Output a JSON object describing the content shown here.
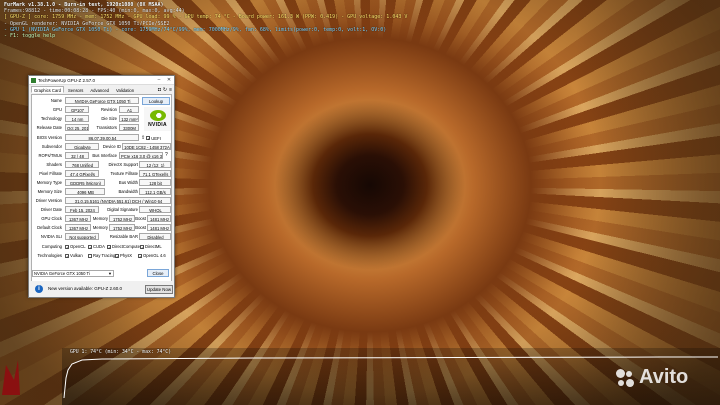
{
  "overlay": {
    "lines": [
      "FurMark v1.38.1.0 - Burn-in test, 1920x1080 (0X MSAA)",
      "Frames:98812 - time:00:08:28 - FPS:40 (min:0, max:0, avg:44)",
      "[ GPU-Z ] core: 1759 MHz - mem: 1752 MHz - GPU load: 99 % - GPU temp: 74 °C - Board power: 161.3 W (PPW: 0.419) - GPU voltage: 1.043 V",
      "- OpenGL renderer: NVIDIA GeForce GTX 1050 Ti/PCIe/SSE2",
      "- GPU 1 (NVIDIA GeForce GTX 1050 Ti) - core: 1759MHz/74°C/99%, mem: 7000MHz/9%, fan: 68%, limits(power:0, temp:0, volt:1, OV:0)",
      "- F1: toggle help"
    ]
  },
  "gpuz": {
    "title": "TechPowerUp GPU-Z 2.57.0",
    "tabs": [
      "Graphics Card",
      "Sensors",
      "Advanced",
      "Validation"
    ],
    "tab_icons": [
      "camera-icon",
      "refresh-icon",
      "menu-icon"
    ],
    "lookup_label": "Lookup",
    "nvidia_word": "NVIDIA",
    "uefi_label": "UEFI",
    "fields": {
      "name": {
        "label": "Name",
        "value": "NVIDIA GeForce GTX 1050 Ti"
      },
      "gpu": {
        "label": "GPU",
        "value": "GP107"
      },
      "revision": {
        "label": "Revision",
        "value": "A1"
      },
      "technology": {
        "label": "Technology",
        "value": "14 nm"
      },
      "die_size": {
        "label": "Die Size",
        "value": "132 mm²"
      },
      "release_date": {
        "label": "Release Date",
        "value": "Oct 25, 2016"
      },
      "transistors": {
        "label": "Transistors",
        "value": "3300M"
      },
      "bios": {
        "label": "BIOS Version",
        "value": "86.07.39.00.54"
      },
      "subvendor": {
        "label": "Subvendor",
        "value": "Gigabyte"
      },
      "device_id": {
        "label": "Device ID",
        "value": "10DE 1C82 - 1458 372A"
      },
      "rops": {
        "label": "ROPs/TMUs",
        "value": "32 / 48"
      },
      "bus": {
        "label": "Bus Interface",
        "value": "PCIe x16 3.0 @ x16 3.0"
      },
      "shaders": {
        "label": "Shaders",
        "value": "768 Unified"
      },
      "directx": {
        "label": "DirectX Support",
        "value": "12 (12_1)"
      },
      "pixel_fill": {
        "label": "Pixel Fillrate",
        "value": "47.4 GPixel/s"
      },
      "texture_fill": {
        "label": "Texture Fillrate",
        "value": "71.1 GTexel/s"
      },
      "mem_type": {
        "label": "Memory Type",
        "value": "GDDR5 (Micron)"
      },
      "bus_width": {
        "label": "Bus Width",
        "value": "128 bit"
      },
      "mem_size": {
        "label": "Memory Size",
        "value": "4096 MB"
      },
      "bandwidth": {
        "label": "Bandwidth",
        "value": "112.1 GB/s"
      },
      "driver_ver": {
        "label": "Driver Version",
        "value": "31.0.15.5161 (NVIDIA 551.61) DCH / Win10 64"
      },
      "driver_date": {
        "label": "Driver Date",
        "value": "Feb 15, 2024"
      },
      "digital_sig": {
        "label": "Digital Signature",
        "value": "WHQL"
      },
      "gpu_clock": {
        "label": "GPU Clock",
        "value": "1367 MHz"
      },
      "memory_clock": {
        "label": "Memory",
        "value": "1752 MHz"
      },
      "boost_clock": {
        "label": "Boost",
        "value": "1481 MHz"
      },
      "def_clock": {
        "label": "Default Clock",
        "value": "1367 MHz"
      },
      "def_memory": {
        "label": "Memory",
        "value": "1752 MHz"
      },
      "def_boost": {
        "label": "Boost",
        "value": "1481 MHz"
      },
      "sli": {
        "label": "NVIDIA SLI",
        "value": "Not supported"
      },
      "resizable_bar": {
        "label": "Resizable BAR",
        "value": "Disabled"
      }
    },
    "computing_label": "Computing",
    "computing": [
      "OpenCL",
      "CUDA",
      "DirectCompute",
      "DirectML"
    ],
    "technologies_label": "Technologies",
    "technologies": [
      "Vulkan",
      "Ray Tracing",
      "PhysX",
      "OpenGL 4.6"
    ],
    "selected_gpu": "NVIDIA GeForce GTX 1050 Ti",
    "close_label": "Close",
    "update_text": "New version available: GPU-Z 2.60.0",
    "update_button": "Update Now"
  },
  "graph": {
    "label": "GPU 1: 74°C (min: 34°C - max: 74°C)",
    "line_color": "#ffffff"
  },
  "watermark": {
    "text": "Avito"
  }
}
